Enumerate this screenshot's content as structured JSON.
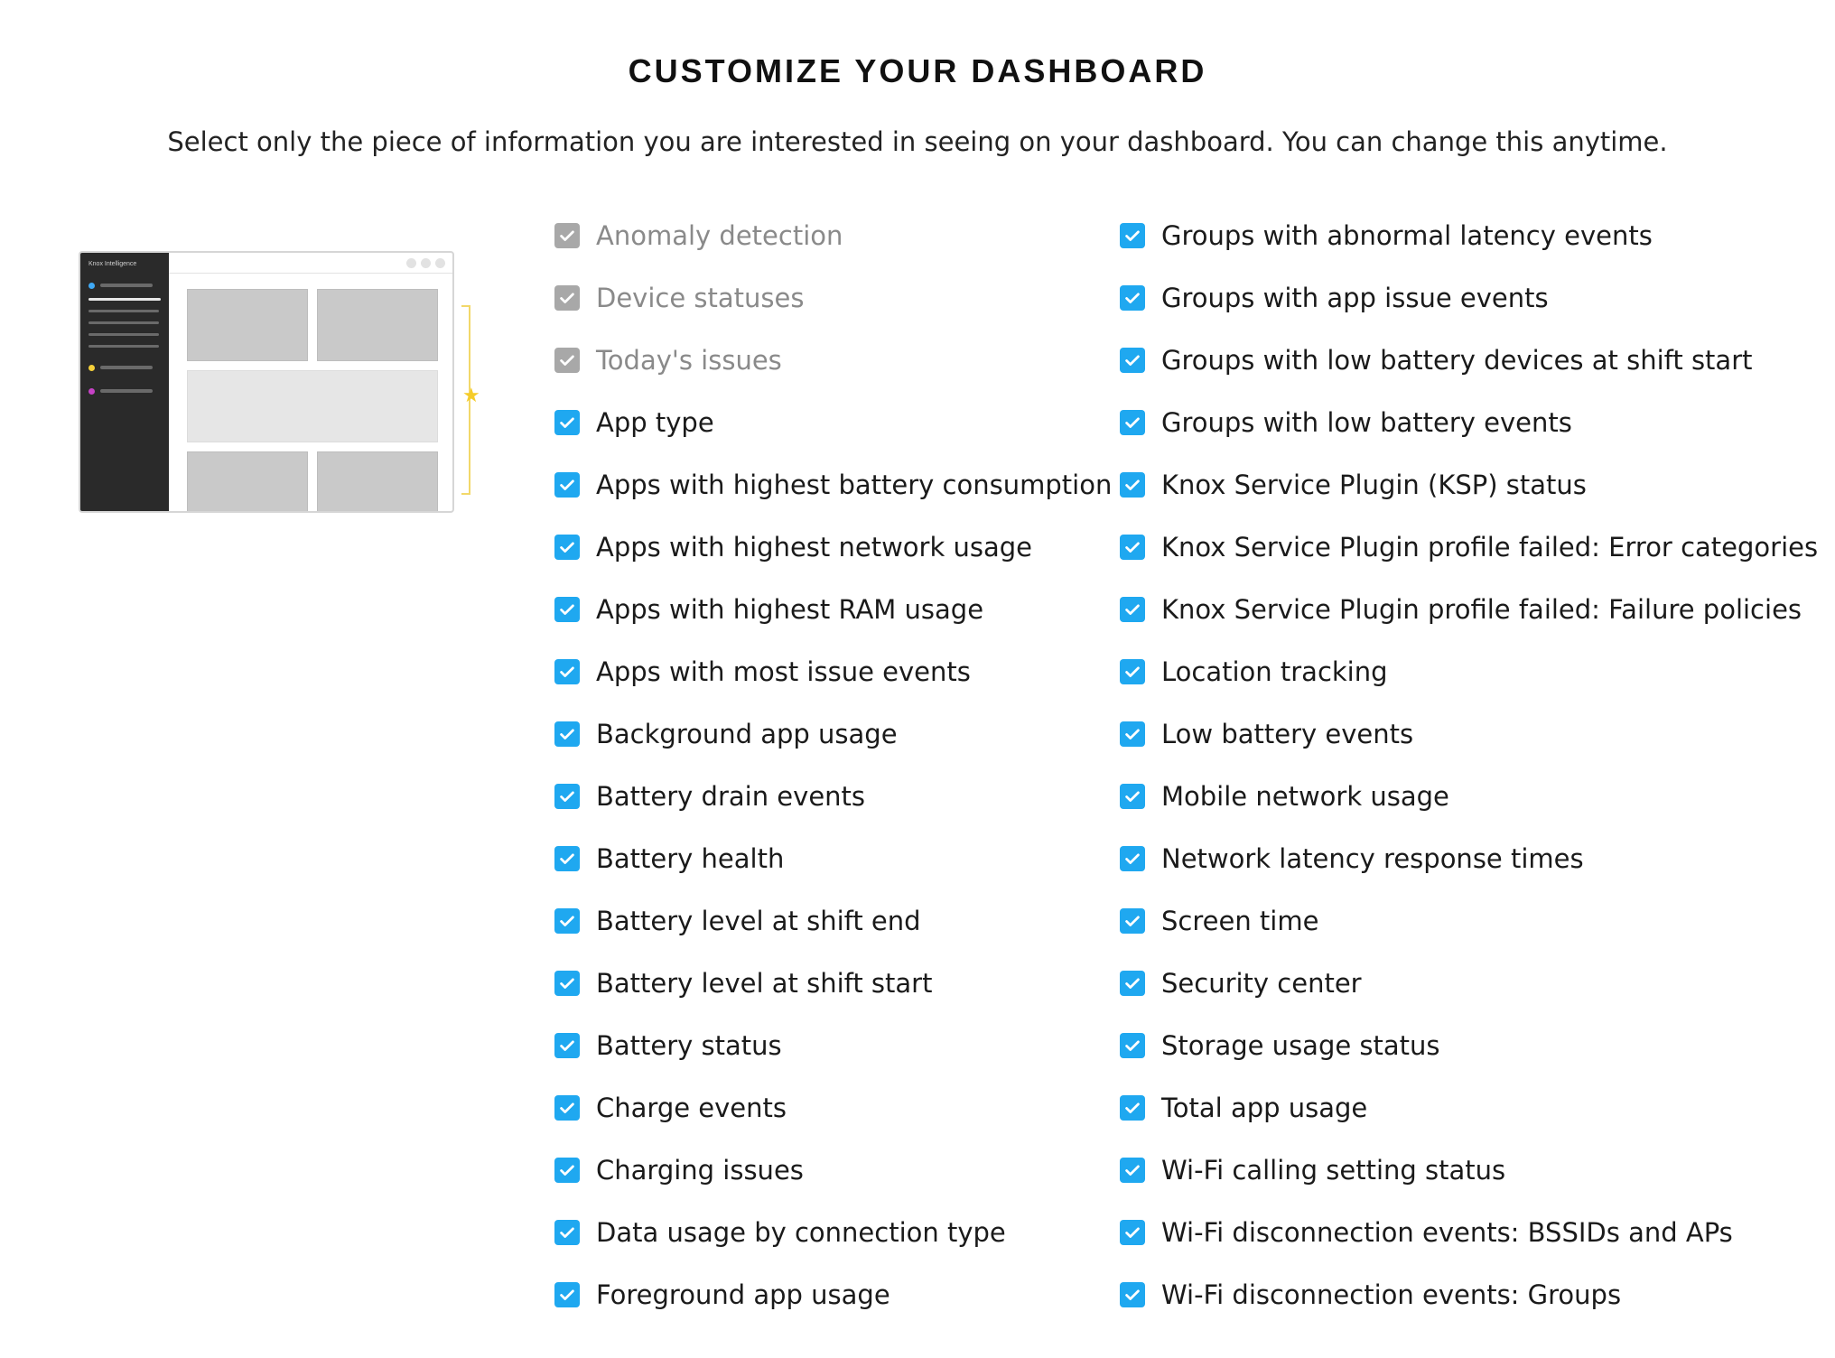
{
  "header": {
    "title": "CUSTOMIZE YOUR DASHBOARD",
    "subtitle": "Select only the piece of information you are interested in seeing on your dashboard. You can change this anytime."
  },
  "illustration": {
    "brand": "Knox Intelligence",
    "dot_colors": [
      "#3fa9f5",
      "#f5d03a",
      "#c642c6"
    ]
  },
  "colors": {
    "checked": "#1fa8f0",
    "fixed": "#a8a8a8",
    "highlight": "#f5cc2a"
  },
  "left_column": [
    {
      "label": "Anomaly detection",
      "state": "fixed"
    },
    {
      "label": "Device statuses",
      "state": "fixed"
    },
    {
      "label": "Today's issues",
      "state": "fixed"
    },
    {
      "label": "App type",
      "state": "checked"
    },
    {
      "label": "Apps with highest battery consumption",
      "state": "checked"
    },
    {
      "label": "Apps with highest network usage",
      "state": "checked"
    },
    {
      "label": "Apps with highest RAM usage",
      "state": "checked"
    },
    {
      "label": "Apps with most issue events",
      "state": "checked"
    },
    {
      "label": "Background app usage",
      "state": "checked"
    },
    {
      "label": "Battery drain events",
      "state": "checked"
    },
    {
      "label": "Battery health",
      "state": "checked"
    },
    {
      "label": "Battery level at shift end",
      "state": "checked"
    },
    {
      "label": "Battery level at shift start",
      "state": "checked"
    },
    {
      "label": "Battery status",
      "state": "checked"
    },
    {
      "label": "Charge events",
      "state": "checked"
    },
    {
      "label": "Charging issues",
      "state": "checked"
    },
    {
      "label": "Data usage by connection type",
      "state": "checked"
    },
    {
      "label": "Foreground app usage",
      "state": "checked"
    }
  ],
  "right_column": [
    {
      "label": "Groups with abnormal latency events",
      "state": "checked"
    },
    {
      "label": "Groups with app issue events",
      "state": "checked"
    },
    {
      "label": "Groups with low battery devices at shift start",
      "state": "checked"
    },
    {
      "label": "Groups with low battery events",
      "state": "checked"
    },
    {
      "label": "Knox Service Plugin (KSP) status",
      "state": "checked"
    },
    {
      "label": "Knox Service Plugin profile failed: Error categories",
      "state": "checked"
    },
    {
      "label": "Knox Service Plugin profile failed: Failure policies",
      "state": "checked"
    },
    {
      "label": "Location tracking",
      "state": "checked"
    },
    {
      "label": "Low battery events",
      "state": "checked"
    },
    {
      "label": "Mobile network usage",
      "state": "checked"
    },
    {
      "label": "Network latency response times",
      "state": "checked"
    },
    {
      "label": "Screen time",
      "state": "checked"
    },
    {
      "label": "Security center",
      "state": "checked"
    },
    {
      "label": "Storage usage status",
      "state": "checked"
    },
    {
      "label": "Total app usage",
      "state": "checked"
    },
    {
      "label": "Wi-Fi calling setting status",
      "state": "checked"
    },
    {
      "label": "Wi-Fi disconnection events: BSSIDs and APs",
      "state": "checked"
    },
    {
      "label": "Wi-Fi disconnection events: Groups",
      "state": "checked"
    }
  ]
}
